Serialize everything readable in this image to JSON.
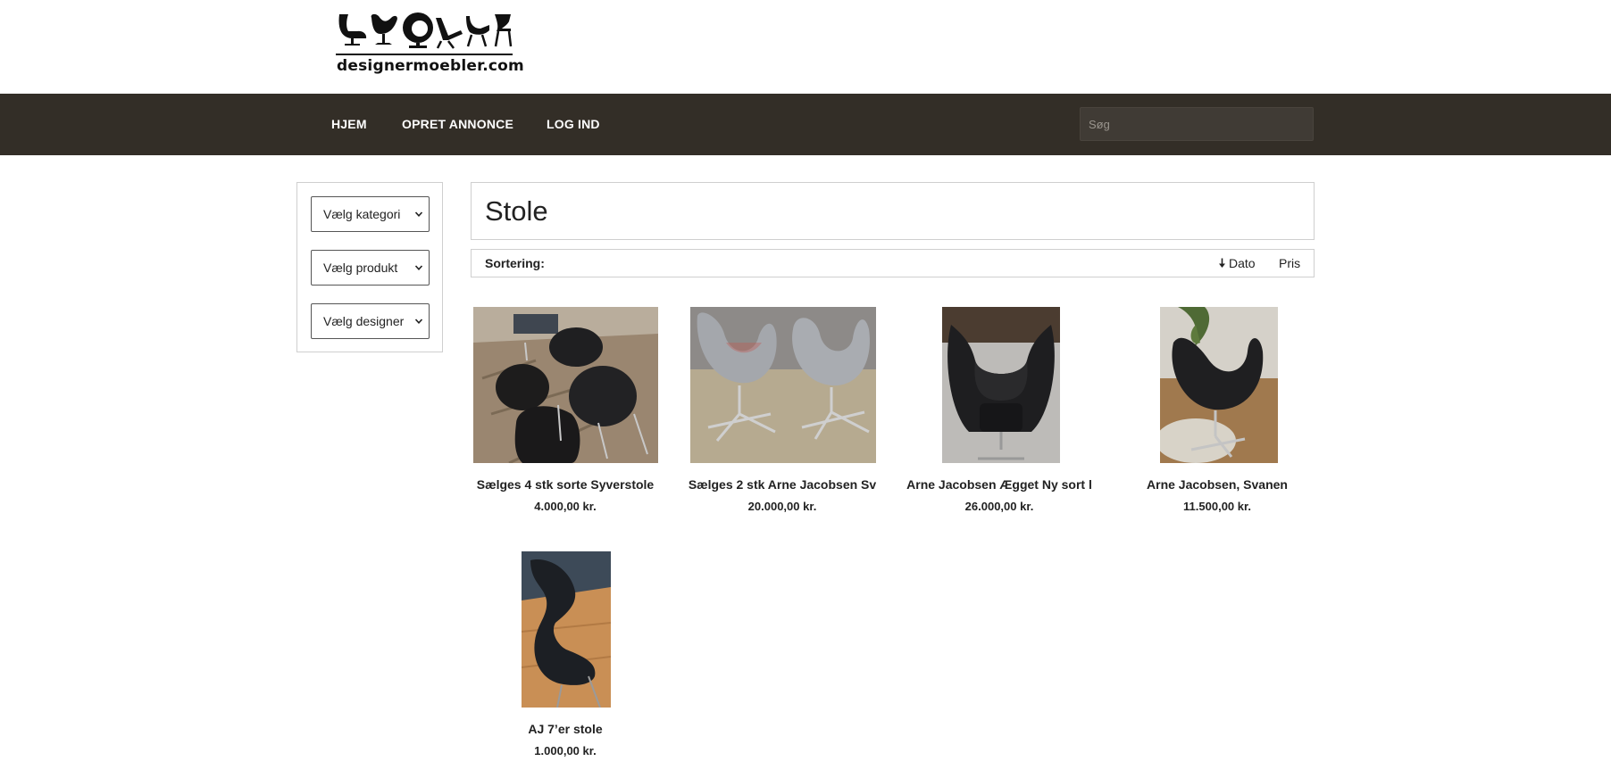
{
  "logo": {
    "text": "designermoebler.com",
    "chair_icons": [
      "egg-chair-icon",
      "swan-chair-icon",
      "ball-chair-icon",
      "lounge-chair-icon",
      "shell-chair-icon",
      "side-chair-icon"
    ]
  },
  "nav": {
    "items": [
      {
        "label": "HJEM"
      },
      {
        "label": "OPRET ANNONCE"
      },
      {
        "label": "LOG IND"
      }
    ],
    "search_placeholder": "Søg"
  },
  "filters": [
    {
      "selected": "Vælg kategori"
    },
    {
      "selected": "Vælg produkt"
    },
    {
      "selected": "Vælg designer"
    }
  ],
  "main": {
    "title": "Stole",
    "sort": {
      "label": "Sortering:",
      "options": [
        {
          "label": "Dato",
          "direction": "down",
          "active": true
        },
        {
          "label": "Pris",
          "active": false
        }
      ]
    },
    "products": [
      {
        "title": "Sælges 4 stk sorte Syverstole",
        "price": "4.000,00 kr.",
        "image": "black-series-7-chairs-photo"
      },
      {
        "title": "Sælges 2 stk Arne Jacobsen Sv",
        "price": "20.000,00 kr.",
        "image": "grey-swan-chairs-photo"
      },
      {
        "title": "Arne Jacobsen Ægget Ny sort l",
        "price": "26.000,00 kr.",
        "image": "black-egg-chair-photo"
      },
      {
        "title": "Arne Jacobsen, Svanen",
        "price": "11.500,00 kr.",
        "image": "black-swan-chair-photo"
      },
      {
        "title": "AJ 7’er stole",
        "price": "1.000,00 kr.",
        "image": "black-7-chair-photo"
      }
    ]
  },
  "colors": {
    "navbar_bg": "#332e27",
    "nav_text": "#ffffff",
    "search_bg": "#403b35",
    "border": "#cfcfcf"
  }
}
